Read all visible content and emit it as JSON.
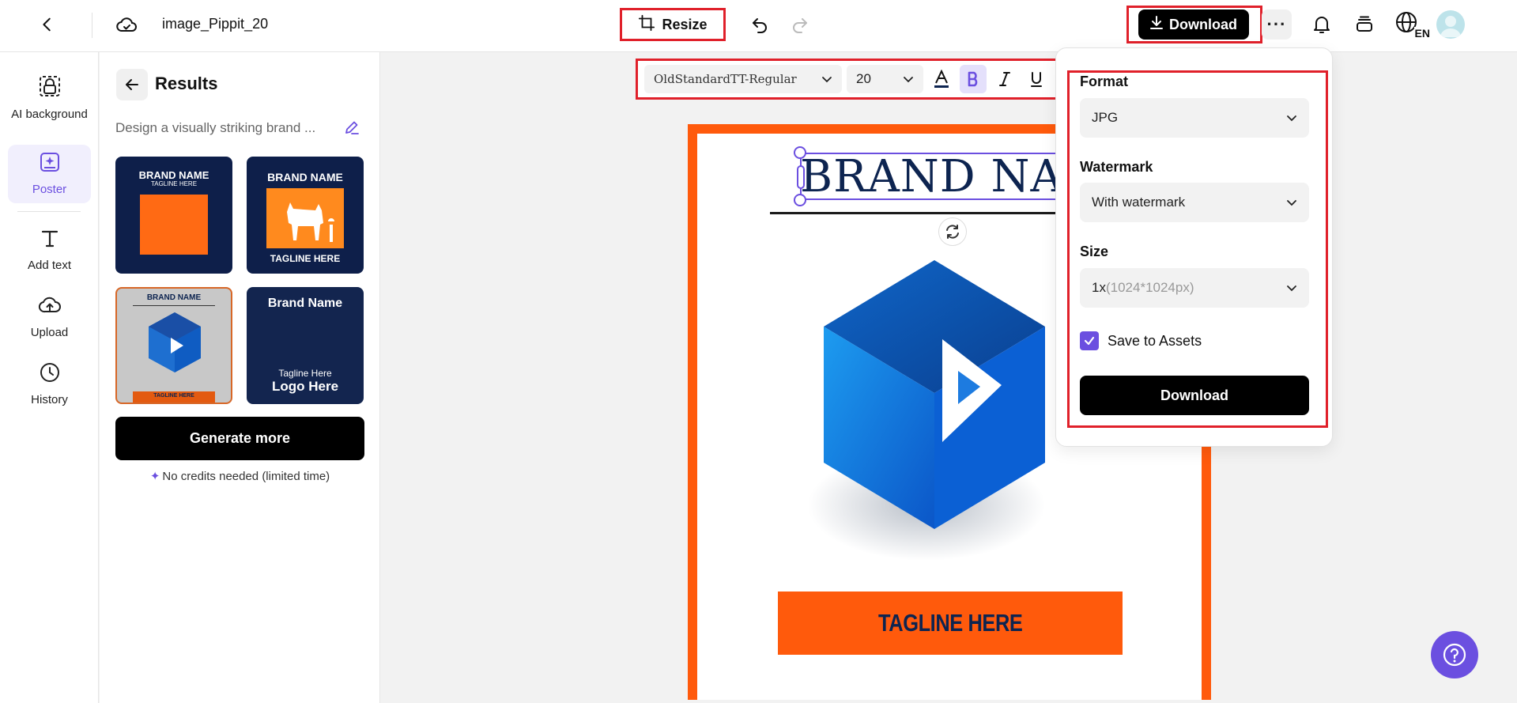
{
  "header": {
    "doc_title": "image_Pippit_20",
    "resize_label": "Resize",
    "download_label": "Download",
    "language_badge": "EN"
  },
  "leftnav": {
    "items": [
      {
        "label": "AI background",
        "icon": "ai-background-icon"
      },
      {
        "label": "Poster",
        "icon": "poster-icon",
        "active": true
      },
      {
        "label": "Add text",
        "icon": "text-icon"
      },
      {
        "label": "Upload",
        "icon": "upload-icon"
      },
      {
        "label": "History",
        "icon": "history-icon"
      }
    ]
  },
  "results": {
    "title": "Results",
    "prompt": "Design a visually striking brand ...",
    "thumbs": [
      {
        "brand": "BRAND NAME",
        "tagline": "TAGLINE HERE"
      },
      {
        "brand": "BRAND NAME",
        "tagline": "TAGLINE HERE"
      },
      {
        "brand": "BRAND NAME",
        "tagline": "TAGLINE HERE"
      },
      {
        "brand": "Brand Name",
        "tagline": "Tagline Here",
        "logo": "Logo Here"
      }
    ],
    "generate_label": "Generate more",
    "credits_note": "No credits needed (limited time)"
  },
  "text_toolbar": {
    "font": "OldStandardTT-Regular",
    "size": "20",
    "bold_active": true
  },
  "poster": {
    "brand_text": "BRAND NAME",
    "tagline": "TAGLINE HERE"
  },
  "download_panel": {
    "format_label": "Format",
    "format_value": "JPG",
    "watermark_label": "Watermark",
    "watermark_value": "With watermark",
    "size_label": "Size",
    "size_value": "1x",
    "size_detail": "(1024*1024px)",
    "save_assets_label": "Save to Assets",
    "save_assets_checked": true,
    "download_label": "Download"
  },
  "colors": {
    "accent": "#6b4fe0",
    "highlight_outline": "#e0202a",
    "poster_orange": "#ff5a0c",
    "navy": "#0d2450"
  }
}
